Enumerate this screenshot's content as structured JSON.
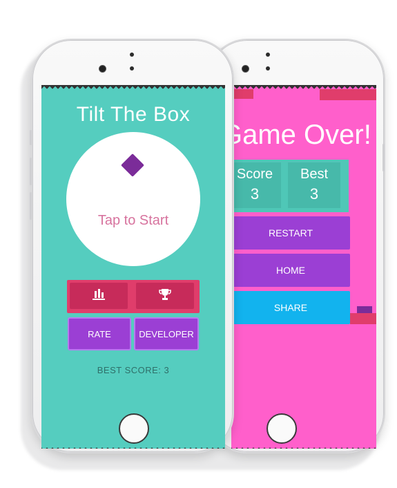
{
  "front_screen": {
    "title": "Tilt The Box",
    "tap_text": "Tap to Start",
    "leaderboard_icon": "bar-chart-icon",
    "trophy_icon": "trophy-icon",
    "rate_label": "RATE",
    "developer_label": "DEVELOPER",
    "best_score_text": "BEST SCORE: 3",
    "colors": {
      "background": "#55cdbf",
      "accent_red": "#e03d6b",
      "purple": "#9b3fd4",
      "diamond": "#7b2c99"
    }
  },
  "back_screen": {
    "game_over_text": "Game Over!",
    "score_label": "Score",
    "score_value": "3",
    "best_label": "Best",
    "best_value": "3",
    "restart_label": "RESTART",
    "home_label": "HOME",
    "share_label": "SHARE",
    "colors": {
      "background": "#ff5fcb",
      "teal": "#4fc7b7",
      "purple": "#9b3fd4",
      "blue": "#12b3ee"
    }
  }
}
